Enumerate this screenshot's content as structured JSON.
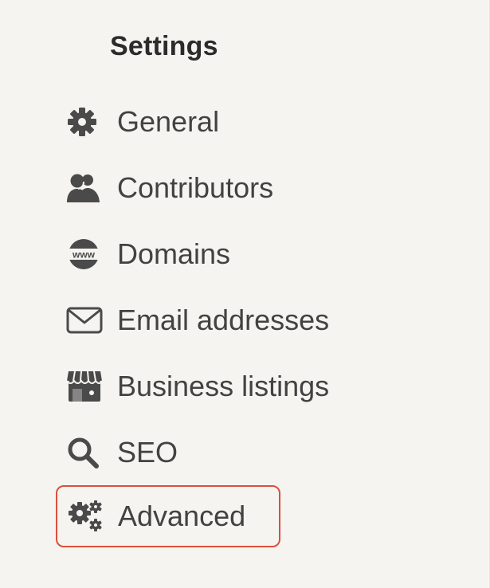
{
  "settings": {
    "title": "Settings",
    "items": [
      {
        "label": "General",
        "icon": "gear-icon"
      },
      {
        "label": "Contributors",
        "icon": "contributors-icon"
      },
      {
        "label": "Domains",
        "icon": "www-globe-icon"
      },
      {
        "label": "Email addresses",
        "icon": "envelope-icon"
      },
      {
        "label": "Business listings",
        "icon": "storefront-icon"
      },
      {
        "label": "SEO",
        "icon": "search-icon"
      },
      {
        "label": "Advanced",
        "icon": "gears-icon",
        "selected": true
      }
    ]
  },
  "colors": {
    "background": "#f5f4f0",
    "text": "#424242",
    "icon": "#4a4a4a",
    "selection_border": "#d9503c"
  }
}
